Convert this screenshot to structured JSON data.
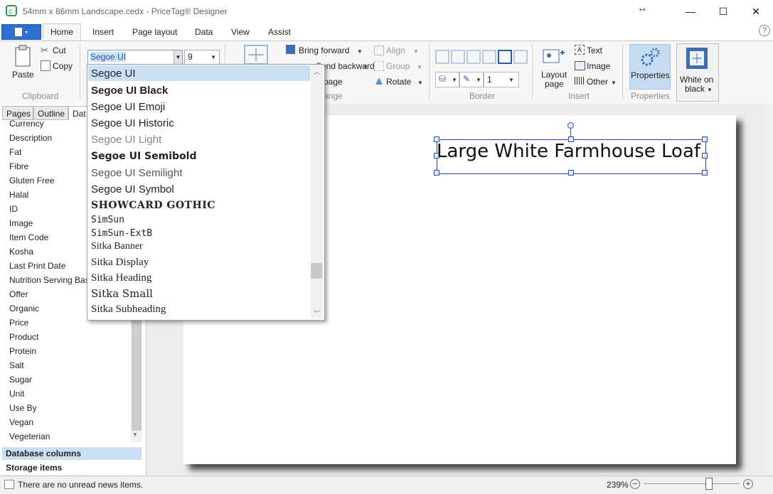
{
  "window": {
    "title": "54mm x 86mm Landscape.cedx - PriceTag® Designer",
    "resize_icon": "↔",
    "minimize_icon": "—",
    "maximize_icon": "☐",
    "close_icon": "✕"
  },
  "ribbon": {
    "tabs": [
      "Home",
      "Insert",
      "Page layout",
      "Data",
      "View",
      "Assist"
    ],
    "help_icon": "?",
    "clipboard": {
      "paste": "Paste",
      "cut": "Cut",
      "copy": "Copy",
      "group": "Clipboard"
    },
    "font": {
      "family": "Segoe UI",
      "size": "9"
    },
    "arrange": {
      "bring_forward": "Bring forward",
      "send_backward": "Send backward",
      "page_partial": "page",
      "align": "Align",
      "group": "Group",
      "rotate": "Rotate",
      "group_label_partial": "ange"
    },
    "border": {
      "width": "1",
      "group": "Border"
    },
    "insert": {
      "layout_page_line1": "Layout",
      "layout_page_line2": "page",
      "text": "Text",
      "image": "Image",
      "other": "Other",
      "group": "Insert"
    },
    "properties": {
      "button": "Properties",
      "group": "Properties"
    },
    "white_on_black": {
      "line1": "White on",
      "line2": "black"
    }
  },
  "left_panel": {
    "tabs": [
      "Pages",
      "Outline",
      "Dat"
    ],
    "fields": [
      "Currency",
      "Description",
      "Fat",
      "Fibre",
      "Gluten Free",
      "Halal",
      "ID",
      "Image",
      "Item Code",
      "Kosha",
      "Last Print Date",
      "Nutrition Serving Bas",
      "Offer",
      "Organic",
      "Price",
      "Product",
      "Protein",
      "Salt",
      "Sugar",
      "Unit",
      "Use By",
      "Vegan",
      "Vegeterian"
    ],
    "database_columns": "Database columns",
    "storage_items": "Storage items"
  },
  "canvas": {
    "label_text": "Large White Farmhouse Loaf"
  },
  "font_dropdown": {
    "items": [
      "Segoe UI",
      "Segoe UI Black",
      "Segoe UI Emoji",
      "Segoe UI Historic",
      "Segoe UI Light",
      "Segoe UI Semibold",
      "Segoe UI Semilight",
      "Segoe UI Symbol",
      "SHOWCARD GOTHIC",
      "SimSun",
      "SimSun-ExtB",
      "Sitka Banner",
      "Sitka Display",
      "Sitka Heading",
      "Sitka Small",
      "Sitka Subheading"
    ],
    "selected": "Segoe UI"
  },
  "status": {
    "news": "There are no unread news items.",
    "zoom": "239%"
  },
  "colors": {
    "accent": "#2f6fce",
    "selection": "#cce0f5",
    "properties_bg": "#c5dcf2"
  }
}
